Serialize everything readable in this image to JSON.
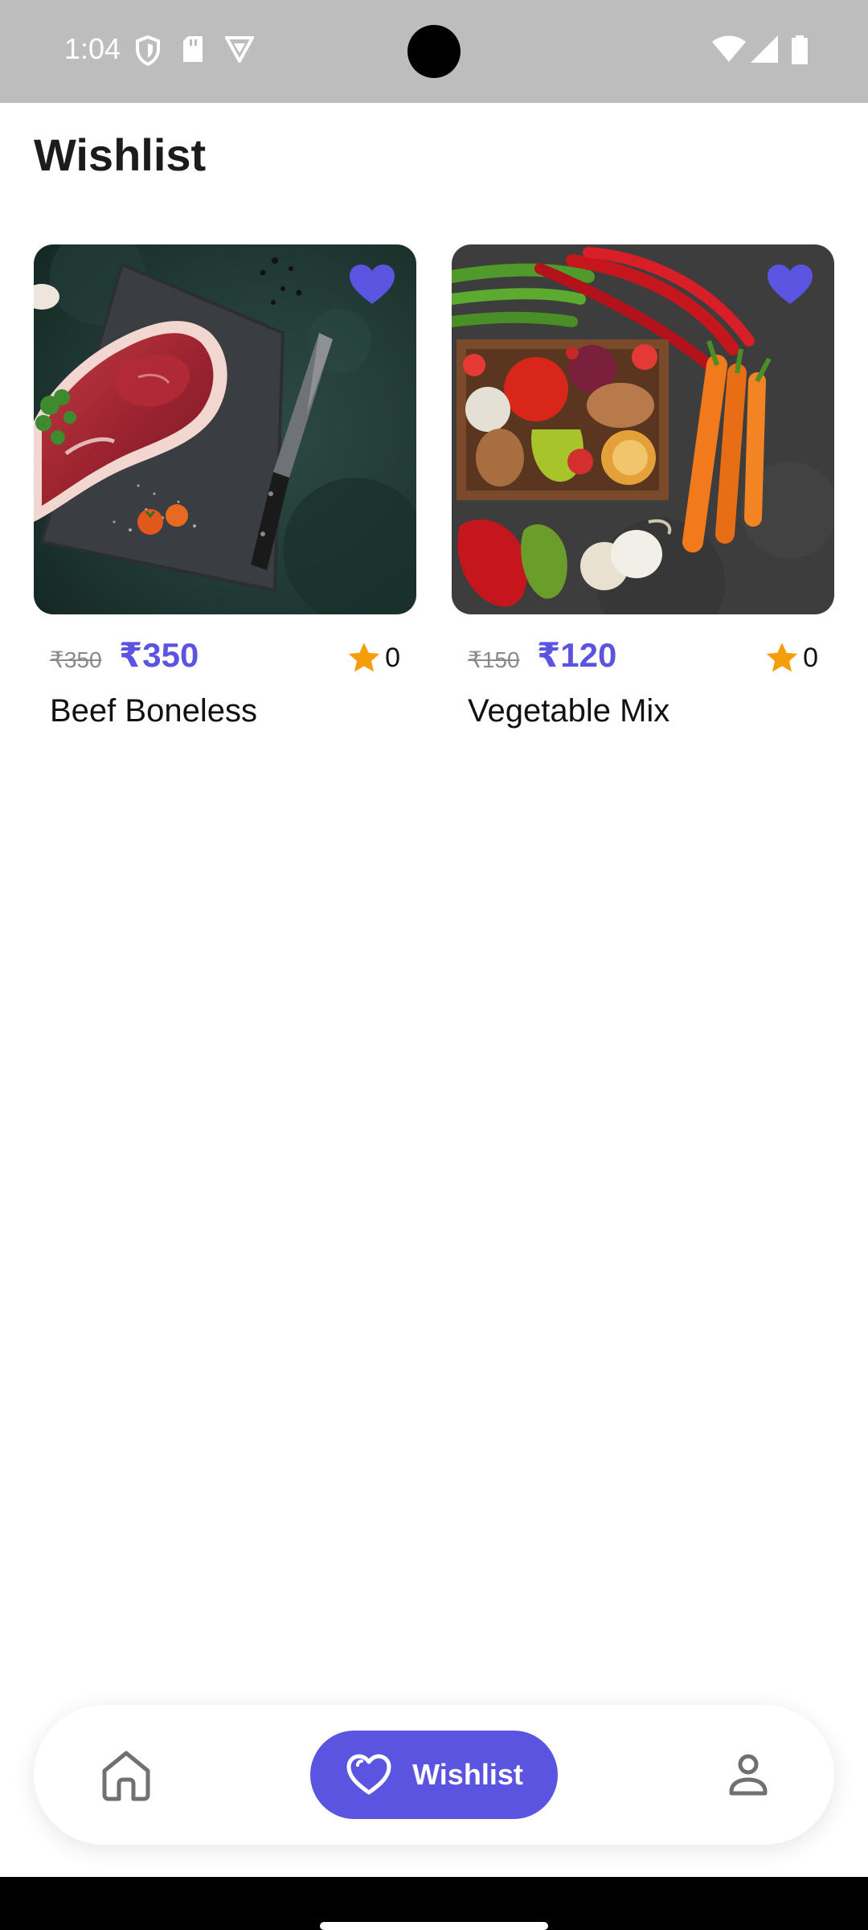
{
  "status_bar": {
    "time": "1:04",
    "icons": [
      "shield-icon",
      "sd-card-icon",
      "vpn-icon",
      "wifi-icon",
      "signal-icon",
      "battery-icon"
    ]
  },
  "page": {
    "title": "Wishlist"
  },
  "products": [
    {
      "name": "Beef Boneless",
      "old_price": "₹350",
      "new_price": "₹350",
      "rating": "0",
      "favorited": true,
      "image": "raw-beef-steak-photo"
    },
    {
      "name": "Vegetable Mix",
      "old_price": "₹150",
      "new_price": "₹120",
      "rating": "0",
      "favorited": true,
      "image": "mixed-vegetables-photo"
    }
  ],
  "bottom_nav": {
    "items": [
      {
        "id": "home",
        "icon": "home-icon"
      },
      {
        "id": "wishlist",
        "icon": "heart-icon",
        "label": "Wishlist",
        "active": true
      },
      {
        "id": "profile",
        "icon": "person-icon"
      }
    ]
  },
  "colors": {
    "accent": "#5b54e0",
    "star": "#f59e0b",
    "status_bar": "#bdbdbd"
  }
}
